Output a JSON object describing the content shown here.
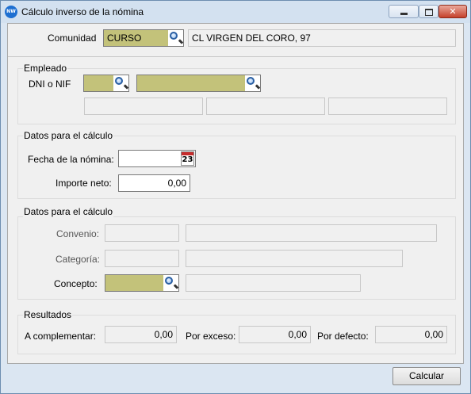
{
  "window": {
    "title": "Cálculo inverso de la nómina",
    "app_icon": "NW"
  },
  "comunidad": {
    "label": "Comunidad",
    "code": "CURSO",
    "address": "CL VIRGEN DEL CORO, 97"
  },
  "empleado": {
    "title": "Empleado",
    "dni_label": "DNI o NIF",
    "dni_value": "",
    "name_value": ""
  },
  "datos_calculo": {
    "title": "Datos para el cálculo",
    "fecha_label": "Fecha de la nómina:",
    "fecha_value": "",
    "calendar_day": "23",
    "importe_label": "Importe neto:",
    "importe_value": "0,00"
  },
  "datos_calculo2": {
    "title": "Datos para el cálculo",
    "convenio_label": "Convenio:",
    "categoria_label": "Categoría:",
    "concepto_label": "Concepto:"
  },
  "resultados": {
    "title": "Resultados",
    "complementar_label": "A complementar:",
    "complementar_value": "0,00",
    "exceso_label": "Por exceso:",
    "exceso_value": "0,00",
    "defecto_label": "Por defecto:",
    "defecto_value": "0,00"
  },
  "footer": {
    "calcular_label": "Calcular"
  }
}
